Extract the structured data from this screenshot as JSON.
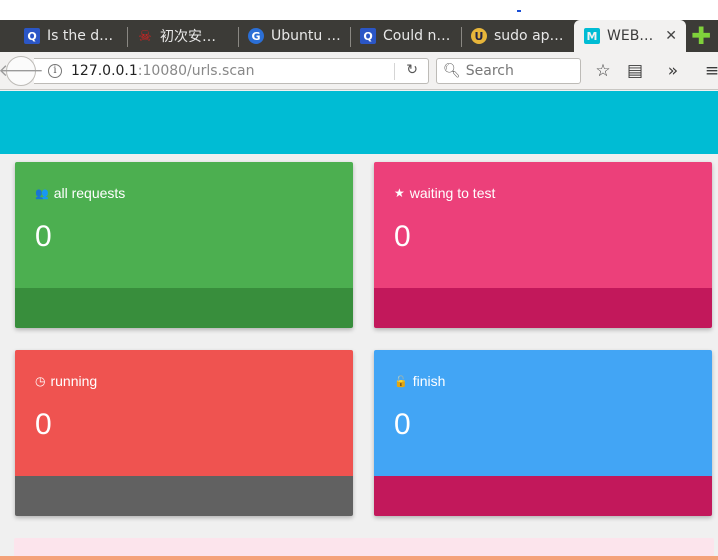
{
  "browser": {
    "tabs": [
      {
        "title": "Is the d…",
        "favicon": "stackexchange-icon",
        "fav_bg": "#2b56c6",
        "fav_text": "Q",
        "active": false
      },
      {
        "title": "初次安…",
        "favicon": "redhat-icon",
        "fav_bg": "transparent",
        "fav_text": "☠",
        "active": false
      },
      {
        "title": "Ubuntu …",
        "favicon": "askubuntu-icon",
        "fav_bg": "#2b6fd6",
        "fav_text": "G",
        "active": false
      },
      {
        "title": "Could n…",
        "favicon": "stackexchange-icon",
        "fav_bg": "#2b56c6",
        "fav_text": "Q",
        "active": false
      },
      {
        "title": "sudo ap…",
        "favicon": "ubuntu-forum-icon",
        "fav_bg": "#e7b53a",
        "fav_text": "U",
        "active": false
      },
      {
        "title": "WEB…",
        "favicon": "material-m-icon",
        "fav_bg": "#00bcd4",
        "fav_text": "M",
        "active": true
      }
    ],
    "close_glyph": "✕",
    "new_tab_glyph": "✚",
    "url_host": "127.0.0.1",
    "url_rest": ":10080/urls.scan",
    "search_placeholder": "Search"
  },
  "cards": [
    {
      "label": "all requests",
      "icon": "users-icon",
      "icon_glyph": "👥",
      "value": "0",
      "top_color": "#4caf50",
      "bottom_color": "#388e3c"
    },
    {
      "label": "waiting to test",
      "icon": "star-icon",
      "icon_glyph": "★",
      "value": "0",
      "top_color": "#ec407a",
      "bottom_color": "#c2185b"
    },
    {
      "label": "running",
      "icon": "clock-icon",
      "icon_glyph": "◷",
      "value": "0",
      "top_color": "#ef5350",
      "bottom_color": "#616161"
    },
    {
      "label": "finish",
      "icon": "lock-icon",
      "icon_glyph": "🔓",
      "value": "0",
      "top_color": "#42a5f5",
      "bottom_color": "#c2185b"
    }
  ],
  "colors": {
    "header": "#00bcd4"
  }
}
